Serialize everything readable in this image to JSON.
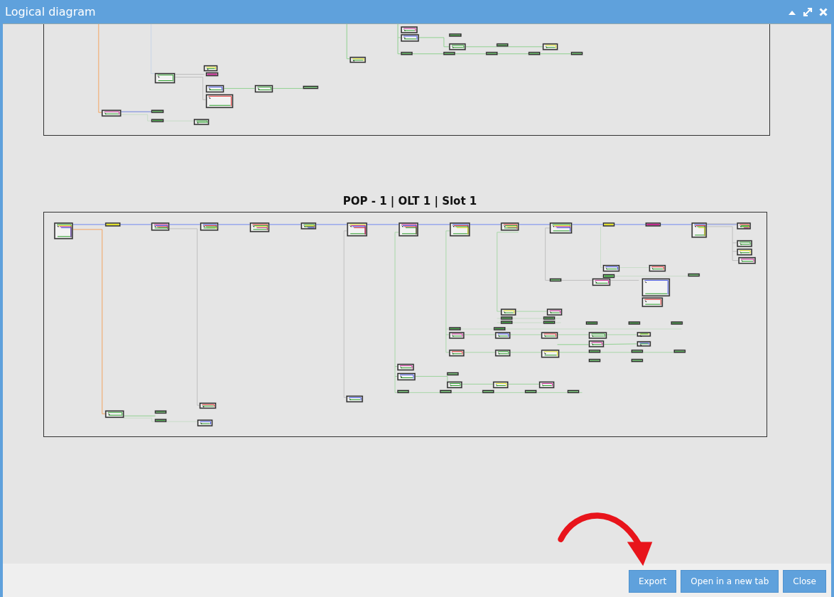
{
  "window": {
    "title": "Logical diagram"
  },
  "window_controls": [
    {
      "kind": "collapse"
    },
    {
      "kind": "maximize"
    },
    {
      "kind": "close"
    }
  ],
  "diagrams": [
    {
      "kind": "partial"
    },
    {
      "kind": "full",
      "title": "POP - 1 | OLT 1 | Slot 1"
    }
  ],
  "buttons": [
    "Export",
    "Open in a new tab",
    "Close"
  ]
}
